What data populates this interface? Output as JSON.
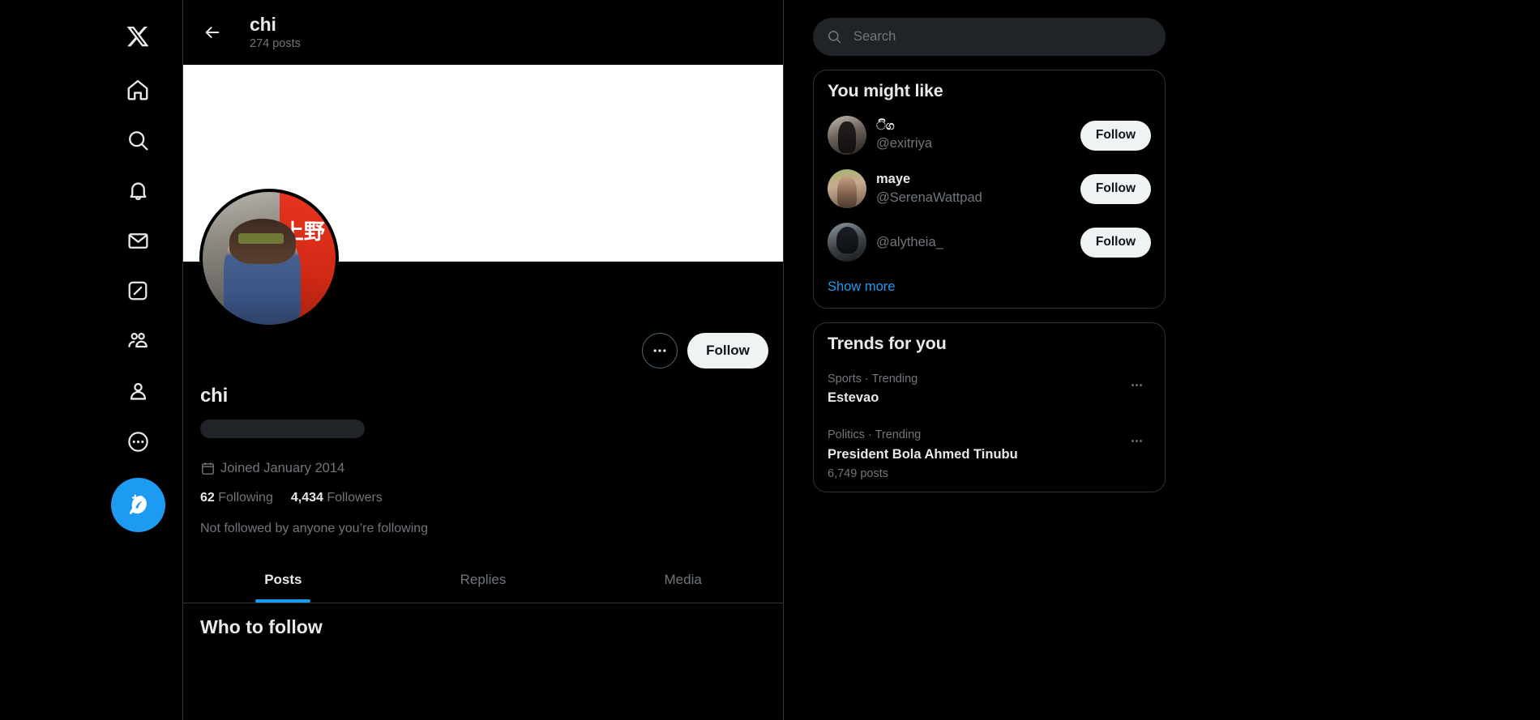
{
  "colors": {
    "accent": "#1d9bf0",
    "background": "#000000",
    "text_primary": "#e7e9ea",
    "text_secondary": "#71767b",
    "border": "#2f3336",
    "button_light": "#eff3f4",
    "skeleton": "#202327"
  },
  "leftnav": {
    "items": [
      {
        "icon": "x-logo-icon",
        "label": "X"
      },
      {
        "icon": "home-icon",
        "label": "Home"
      },
      {
        "icon": "search-icon",
        "label": "Explore"
      },
      {
        "icon": "bell-icon",
        "label": "Notifications"
      },
      {
        "icon": "mail-icon",
        "label": "Messages"
      },
      {
        "icon": "grok-icon",
        "label": "Grok"
      },
      {
        "icon": "communities-icon",
        "label": "Communities"
      },
      {
        "icon": "profile-icon",
        "label": "Profile"
      },
      {
        "icon": "more-icon",
        "label": "More"
      }
    ],
    "compose": {
      "icon": "compose-post-icon",
      "label": "Post"
    }
  },
  "profile_header": {
    "back_label": "Back",
    "name": "chi",
    "posts": "274 posts"
  },
  "profile": {
    "display_name": "chi",
    "handle_placeholder": "",
    "joined": "Joined January 2014",
    "following_count": "62",
    "following_label": "Following",
    "followers_count": "4,434",
    "followers_label": "Followers",
    "followed_by": "Not followed by anyone you’re following",
    "more_label": "More",
    "follow_label": "Follow",
    "avatar_kanji": "上野"
  },
  "tabs": [
    {
      "label": "Posts",
      "active": true
    },
    {
      "label": "Replies",
      "active": false
    },
    {
      "label": "Media",
      "active": false
    }
  ],
  "timeline": {
    "who_to_follow_title": "Who to follow"
  },
  "search": {
    "placeholder": "Search",
    "value": "",
    "icon": "search-icon"
  },
  "you_might_like": {
    "title": "You might like",
    "accounts": [
      {
        "name": "ිග",
        "handle": "@exitriya",
        "follow_label": "Follow",
        "is_glyph": true
      },
      {
        "name": "maye",
        "handle": "@SerenaWattpad",
        "follow_label": "Follow",
        "is_glyph": false
      },
      {
        "name": "",
        "handle": "@alytheia_",
        "follow_label": "Follow",
        "is_glyph": false
      }
    ],
    "show_more": "Show more"
  },
  "trends": {
    "title": "Trends for you",
    "items": [
      {
        "category": "Sports · Trending",
        "name": "Estevao",
        "count": ""
      },
      {
        "category": "Politics · Trending",
        "name": "President Bola Ahmed Tinubu",
        "count": "6,749 posts"
      }
    ],
    "more_icon": "more-horizontal-icon"
  }
}
